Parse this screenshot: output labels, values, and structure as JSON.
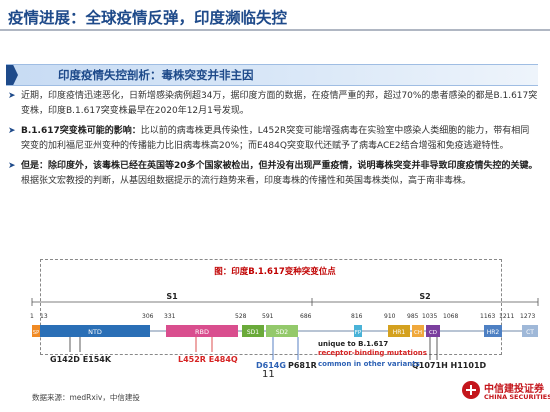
{
  "header": {
    "title": "疫情进展：全球疫情反弹，印度濒临失控"
  },
  "section": {
    "title": "印度疫情失控剖析：毒株突变并非主因"
  },
  "bullets": [
    {
      "lead": "",
      "text": "近期，印度疫情迅速恶化，日新增感染病例超34万，据印度方面的数据，在疫情严重的邦，超过70%的患者感染的都是B.1.617突变株，印度B.1.617突变株最早在2020年12月1号发现。"
    },
    {
      "lead": "B.1.617突变株可能的影响：",
      "text": "比以前的病毒株更具传染性，L452R突变可能增强病毒在实验室中感染人类细胞的能力，带有相同突变的加利福尼亚州变种的传播能力比旧病毒株高20%；而E484Q突变取代还赋予了病毒ACE2结合增强和免疫逃避特性。"
    },
    {
      "lead": "但是：除印度外，该毒株已经在英国等20多个国家被检出，但并没有出现严重疫情，说明毒株突变并非导致印度疫情失控的关键。",
      "text": "根据张文宏教授的判断，从基因组数据提示的流行趋势来看，印度毒株的传播性和英国毒株类似，高于南非毒株。"
    }
  ],
  "figure": {
    "title": "图：印度B.1.617变种突变位点",
    "s1_label": "S1",
    "s2_label": "S2",
    "positions": [
      "1",
      "13",
      "306",
      "331",
      "528",
      "591",
      "686",
      "816",
      "910",
      "985",
      "1035",
      "1068",
      "1163",
      "1211",
      "1273"
    ],
    "domains": [
      "SP",
      "NTD",
      "RBD",
      "SD1",
      "SD2",
      "FP",
      "HR1",
      "CH",
      "CD",
      "HR2",
      "CT"
    ],
    "mutations": {
      "ntd": "G142D E154K",
      "rbd": "L452R E484Q",
      "d614g": "D614G",
      "p681r": "P681R",
      "cd": "Q1071H H1101D"
    },
    "legend": {
      "unique": "unique to B.1.617",
      "rbm": "receptor-binding mutations",
      "common": "common in other variants"
    },
    "colors": {
      "rbd_mut": "#d62424",
      "common_mut": "#2e62b5",
      "ntd": "#2a6fb6",
      "rbd": "#d94e8e",
      "sd": "#6aaa3a",
      "fp": "#4ab3d8",
      "hr1": "#d4a11f",
      "ch": "#f0a93d",
      "cd": "#7b3f9e",
      "hr2": "#4e80c3",
      "ct": "#9fb8d8",
      "sp": "#f08a24"
    }
  },
  "footer": {
    "source": "数据来源：medRxiv，中信建投",
    "page": "11"
  },
  "logo": {
    "cn": "中信建投证券",
    "en": "CHINA SECURITIES"
  }
}
